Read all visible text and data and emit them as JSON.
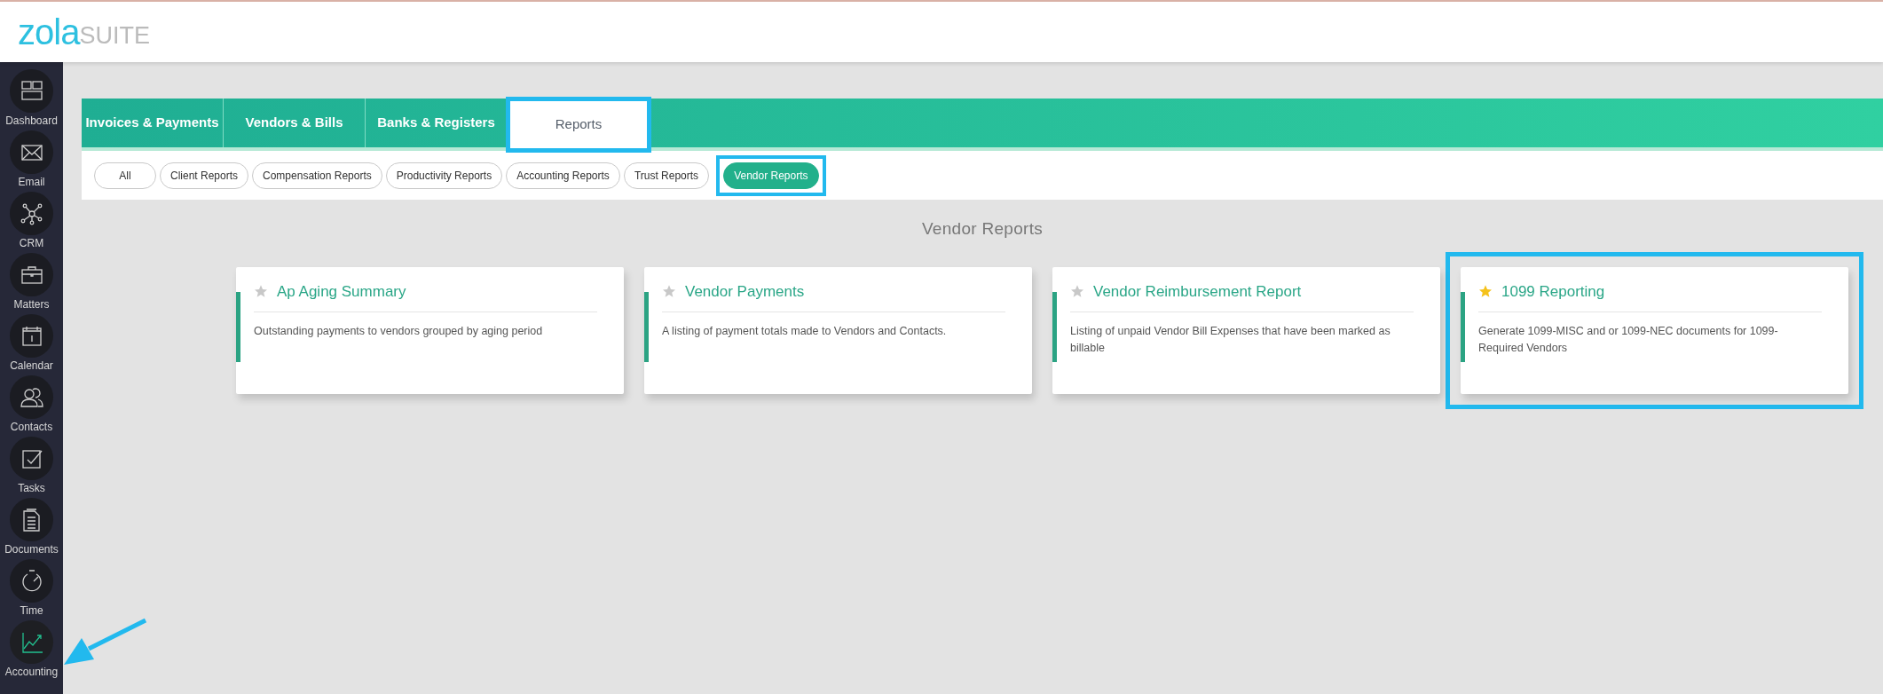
{
  "logo": {
    "primary": "zola",
    "secondary": "SUITE"
  },
  "sidebar": {
    "items": [
      {
        "label": "Dashboard",
        "kind": "dashboard",
        "selected": false,
        "pointed_at": false
      },
      {
        "label": "Email",
        "kind": "email",
        "selected": false,
        "pointed_at": false
      },
      {
        "label": "CRM",
        "kind": "crm",
        "selected": false,
        "pointed_at": false
      },
      {
        "label": "Matters",
        "kind": "matters",
        "selected": false,
        "pointed_at": false
      },
      {
        "label": "Calendar",
        "kind": "calendar",
        "selected": false,
        "pointed_at": false
      },
      {
        "label": "Contacts",
        "kind": "contacts",
        "selected": false,
        "pointed_at": false
      },
      {
        "label": "Tasks",
        "kind": "tasks",
        "selected": false,
        "pointed_at": false
      },
      {
        "label": "Documents",
        "kind": "documents",
        "selected": false,
        "pointed_at": false
      },
      {
        "label": "Time",
        "kind": "time",
        "selected": false,
        "pointed_at": false
      },
      {
        "label": "Accounting",
        "kind": "accounting",
        "selected": true,
        "pointed_at": true
      }
    ]
  },
  "tabs": [
    {
      "label": "Invoices & Payments",
      "selected": false,
      "highlighted": false
    },
    {
      "label": "Vendors & Bills",
      "selected": false,
      "highlighted": false
    },
    {
      "label": "Banks & Registers",
      "selected": false,
      "highlighted": false
    },
    {
      "label": "Reports",
      "selected": true,
      "highlighted": true
    }
  ],
  "filters": [
    {
      "label": "All",
      "selected": false,
      "highlighted": false
    },
    {
      "label": "Client Reports",
      "selected": false,
      "highlighted": false
    },
    {
      "label": "Compensation Reports",
      "selected": false,
      "highlighted": false
    },
    {
      "label": "Productivity Reports",
      "selected": false,
      "highlighted": false
    },
    {
      "label": "Accounting Reports",
      "selected": false,
      "highlighted": false
    },
    {
      "label": "Trust Reports",
      "selected": false,
      "highlighted": false
    },
    {
      "label": "Vendor Reports",
      "selected": true,
      "highlighted": true
    }
  ],
  "section_title": "Vendor Reports",
  "reports": [
    {
      "title": "Ap Aging Summary",
      "description": "Outstanding payments to vendors grouped by aging period",
      "starred": false,
      "highlighted": false
    },
    {
      "title": "Vendor Payments",
      "description": "A listing of payment totals made to Vendors and Contacts.",
      "starred": false,
      "highlighted": false
    },
    {
      "title": "Vendor Reimbursement Report",
      "description": "Listing of unpaid Vendor Bill Expenses that have been marked as billable",
      "starred": false,
      "highlighted": false
    },
    {
      "title": "1099 Reporting",
      "description": "Generate 1099-MISC and or 1099-NEC documents for 1099-Required Vendors",
      "starred": true,
      "highlighted": true
    }
  ]
}
